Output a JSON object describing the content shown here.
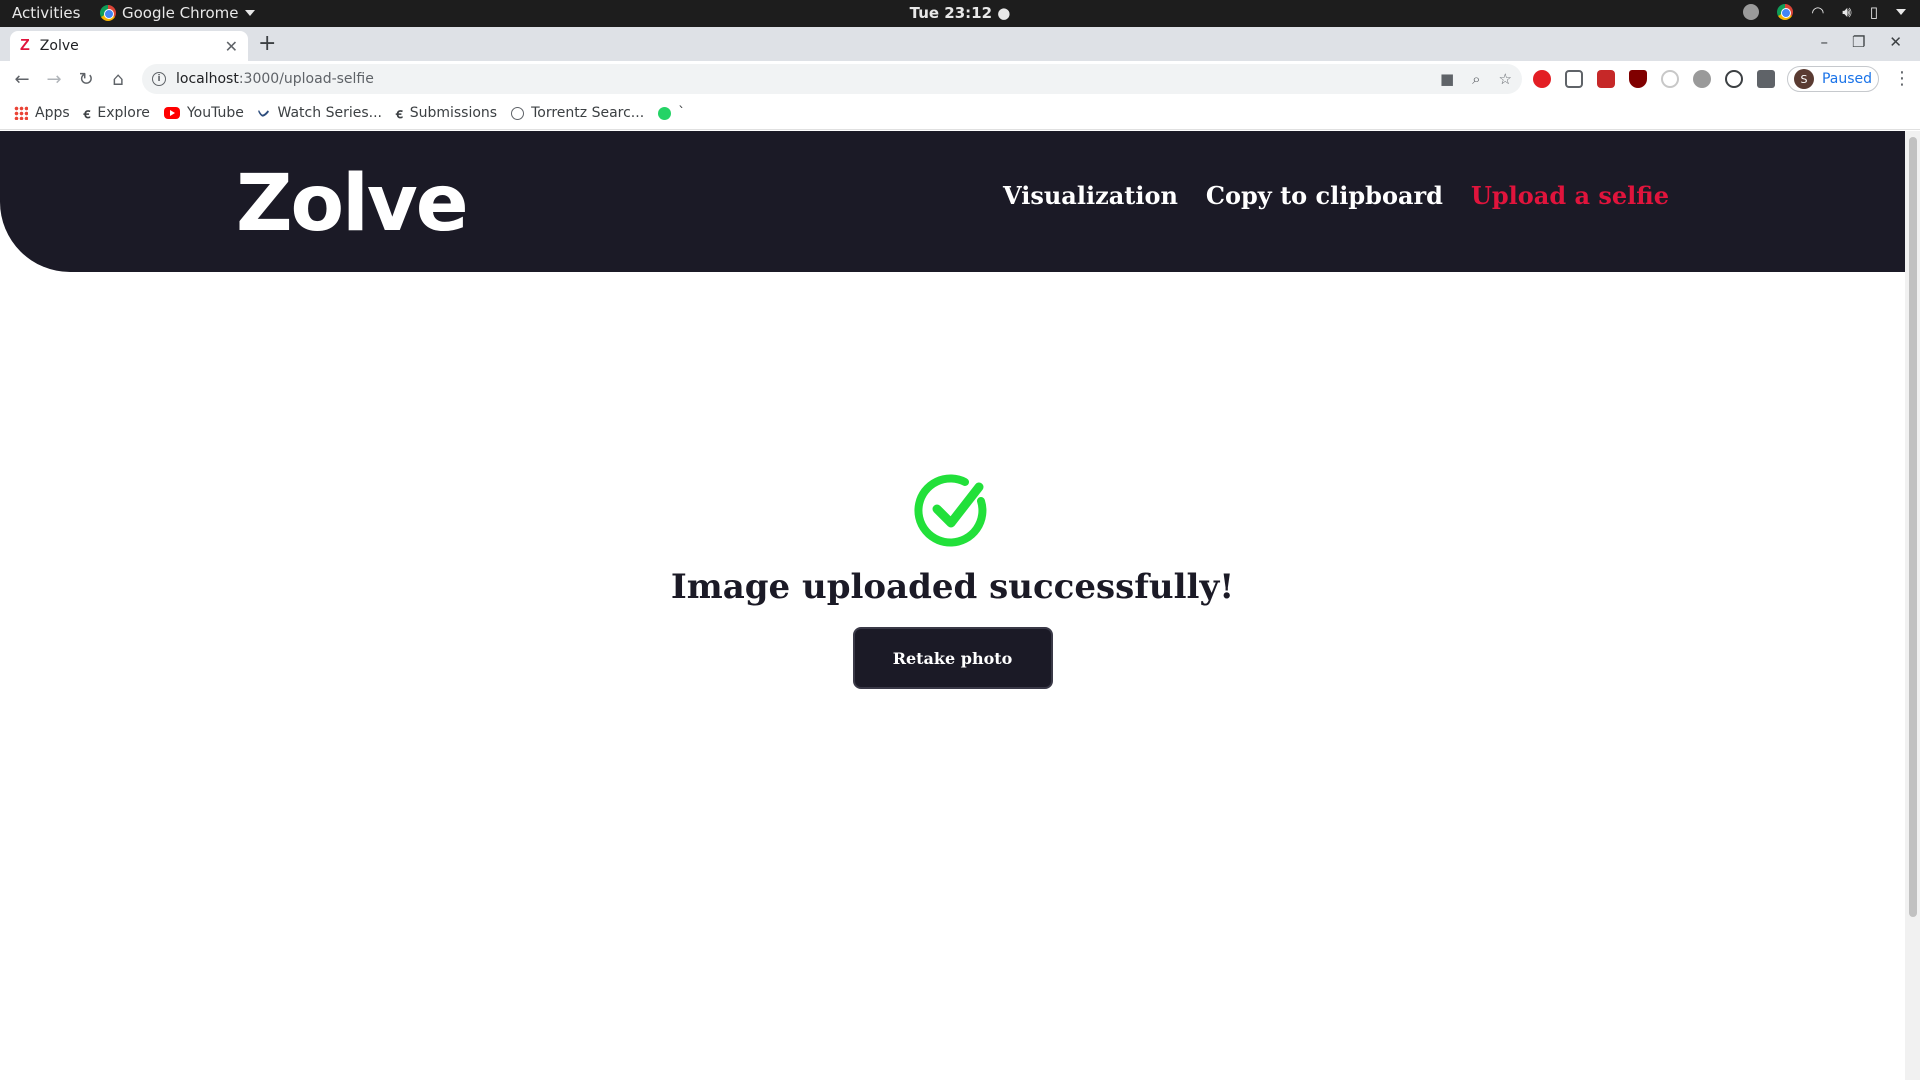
{
  "os_bar": {
    "activities": "Activities",
    "app_name": "Google Chrome",
    "clock": "Tue 23:12 ●"
  },
  "browser": {
    "tab_title": "Zolve",
    "tab_favicon": "Z",
    "url_host": "localhost",
    "url_path": ":3000/upload-selfie",
    "profile_initial": "S",
    "profile_status": "Paused"
  },
  "bookmarks": [
    {
      "label": "Apps",
      "icon": "apps-grid-icon"
    },
    {
      "label": "Explore",
      "icon": "explore-icon"
    },
    {
      "label": "YouTube",
      "icon": "youtube-icon"
    },
    {
      "label": "Watch Series...",
      "icon": "watch-series-icon"
    },
    {
      "label": "Submissions",
      "icon": "submissions-icon"
    },
    {
      "label": "Torrentz Searc...",
      "icon": "globe-icon"
    },
    {
      "label": "`",
      "icon": "whatsapp-icon"
    }
  ],
  "site": {
    "logo": "Zolve",
    "nav": [
      "Visualization",
      "Copy to clipboard",
      "Upload a selfie"
    ],
    "active_nav": "Upload a selfie",
    "success_message": "Image uploaded successfully!",
    "retake_label": "Retake photo"
  },
  "colors": {
    "header_bg": "#1b1a26",
    "accent": "#e0143c",
    "success_green": "#22e03a"
  }
}
